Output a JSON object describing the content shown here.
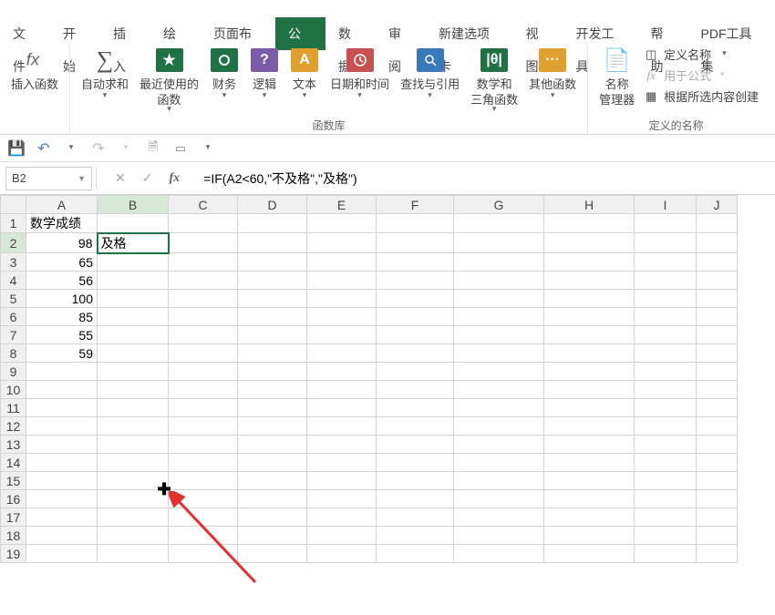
{
  "tabs": [
    "文件",
    "开始",
    "插入",
    "绘图",
    "页面布局",
    "公式",
    "数据",
    "审阅",
    "新建选项卡",
    "视图",
    "开发工具",
    "帮助",
    "PDF工具集"
  ],
  "active_tab": "公式",
  "ribbon": {
    "insert_fn": "插入函数",
    "autosum": "自动求和",
    "recent": "最近使用的\n函数",
    "finance": "财务",
    "logic": "逻辑",
    "text": "文本",
    "datetime": "日期和时间",
    "lookup": "查找与引用",
    "mathtrig": "数学和\n三角函数",
    "other": "其他函数",
    "group_label": "函数库",
    "name_mgr": "名称\n管理器",
    "def_name": "定义名称",
    "use_formula": "用于公式",
    "from_sel": "根据所选内容创建",
    "group_names": "定义的名称"
  },
  "namebox": "B2",
  "formula": "=IF(A2<60,\"不及格\",\"及格\")",
  "cols": [
    "A",
    "B",
    "C",
    "D",
    "E",
    "F",
    "G",
    "H",
    "I",
    "J"
  ],
  "rows": [
    "1",
    "2",
    "3",
    "4",
    "5",
    "6",
    "7",
    "8",
    "9",
    "10",
    "11",
    "12",
    "13",
    "14",
    "15",
    "16",
    "17",
    "18",
    "19"
  ],
  "cells": {
    "A1": "数学成绩",
    "B1": "",
    "A2": "98",
    "B2": "及格",
    "A3": "65",
    "A4": "56",
    "A5": "100",
    "A6": "85",
    "A7": "55",
    "A8": "59"
  },
  "icons": {
    "star": "★",
    "dollar": "$",
    "q": "?",
    "A": "A",
    "clock": "θ",
    "lookup": "🔍",
    "theta": "|θ|",
    "dots": "···",
    "book": "📑",
    "tag": "◫",
    "fx": "fx",
    "sel": "▦"
  },
  "chart_data": null
}
